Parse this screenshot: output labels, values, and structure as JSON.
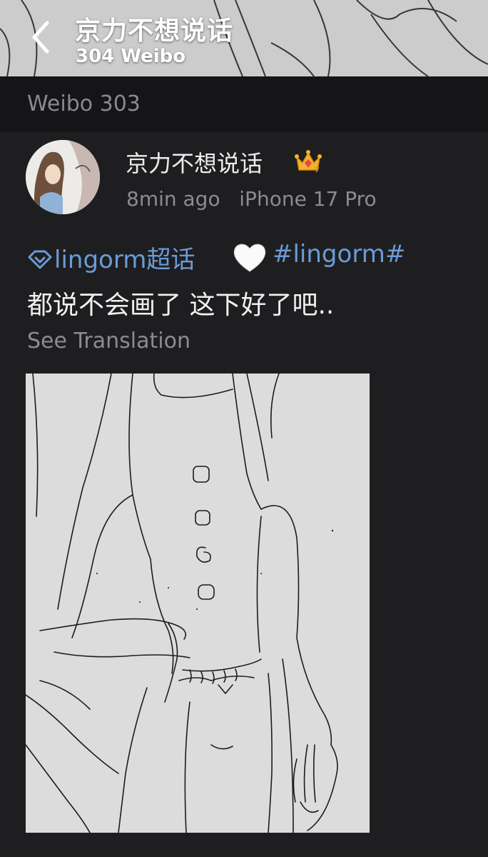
{
  "header": {
    "title": "京力不想说话",
    "subtitle": "304 Weibo"
  },
  "section": {
    "label": "Weibo 303"
  },
  "post": {
    "author": "京力不想说话",
    "time": "8min ago",
    "device": "iPhone 17 Pro",
    "supertopic": "lingorm超话",
    "hashtag": "#lingorm#",
    "text": "都说不会画了 这下好了吧..",
    "translate_label": "See Translation"
  },
  "icons": {
    "back": "chevron-left-icon",
    "crown": "vip-crown-icon",
    "supertopic": "supertopic-diamond-icon",
    "heart": "white-heart-emoji"
  },
  "colors": {
    "background": "#1e1e20",
    "section_bar": "#151517",
    "link": "#6b9bd8",
    "muted": "#8c8c8f",
    "image_bg": "#dcdcdc"
  }
}
